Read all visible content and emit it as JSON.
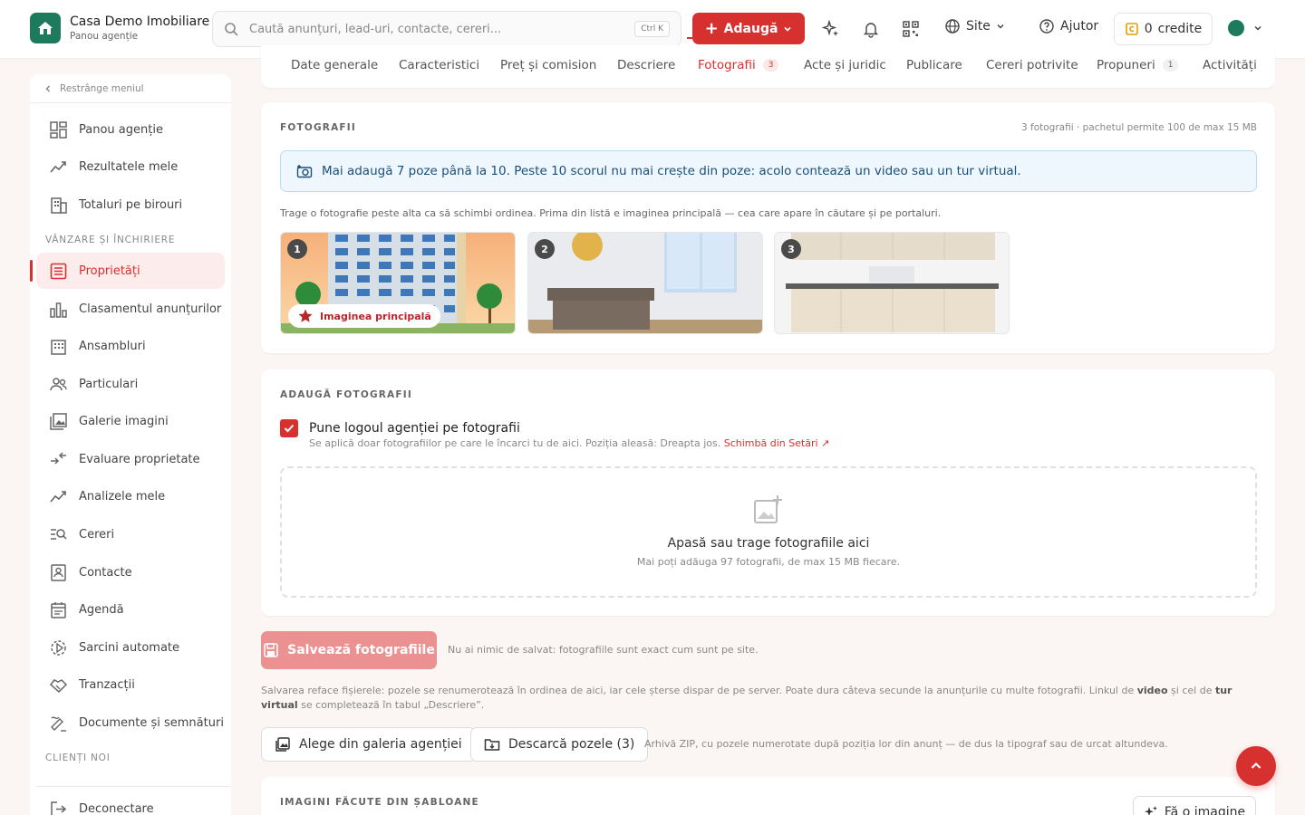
{
  "brand": {
    "name": "Casa Demo Imobiliare",
    "subtitle": "Panou agenție"
  },
  "search": {
    "placeholder": "Caută anunțuri, lead-uri, contacte, cereri...",
    "shortcut": "Ctrl K"
  },
  "header": {
    "add_label": "Adaugă",
    "site_label": "Site",
    "help_label": "Ajutor",
    "credits_count": "0",
    "credits_label": "credite"
  },
  "sidebar": {
    "collapse_label": "Restrânge meniul",
    "items": [
      {
        "label": "Panou agenție",
        "icon": "dashboard-icon"
      },
      {
        "label": "Rezultatele mele",
        "icon": "chart-line-icon"
      },
      {
        "label": "Totaluri pe birouri",
        "icon": "building-icon"
      },
      {
        "label": "Proprietăți",
        "icon": "list-icon",
        "active": true
      },
      {
        "label": "Clasamentul anunțurilor",
        "icon": "bar-chart-icon"
      },
      {
        "label": "Ansambluri",
        "icon": "apartment-icon"
      },
      {
        "label": "Particulari",
        "icon": "users-icon"
      },
      {
        "label": "Galerie imagini",
        "icon": "gallery-icon"
      },
      {
        "label": "Evaluare proprietate",
        "icon": "evaluate-icon"
      },
      {
        "label": "Analizele mele",
        "icon": "analytics-icon"
      },
      {
        "label": "Cereri",
        "icon": "search-list-icon"
      },
      {
        "label": "Contacte",
        "icon": "contacts-icon"
      },
      {
        "label": "Agendă",
        "icon": "calendar-icon"
      },
      {
        "label": "Sarcini automate",
        "icon": "automation-icon"
      },
      {
        "label": "Tranzacții",
        "icon": "handshake-icon"
      },
      {
        "label": "Documente și semnături",
        "icon": "signature-icon"
      },
      {
        "label": "Deconectare",
        "icon": "logout-icon"
      }
    ],
    "sections": [
      "Vânzare și închiriere",
      "Clienți noi"
    ]
  },
  "tabs": [
    {
      "label": "Date generale"
    },
    {
      "label": "Caracteristici"
    },
    {
      "label": "Preț și comision"
    },
    {
      "label": "Descriere"
    },
    {
      "label": "Fotografii",
      "count": "3",
      "active": true
    },
    {
      "label": "Acte și juridic"
    },
    {
      "label": "Publicare"
    },
    {
      "label": "Cereri potrivite"
    },
    {
      "label": "Propuneri",
      "count": "1"
    },
    {
      "label": "Activități"
    }
  ],
  "photos_card": {
    "title": "FOTOGRAFII",
    "meta": "3 fotografii · pachetul permite 100 de max 15 MB",
    "info": "Mai adaugă 7 poze până la 10. Peste 10 scorul nu mai crește din poze: acolo contează un video sau un tur virtual.",
    "hint": "Trage o fotografie peste alta ca să schimbi ordinea. Prima din listă e imaginea principală — cea care apare în căutare și pe portaluri.",
    "photos": [
      {
        "num": "1",
        "badge": "Imaginea principală"
      },
      {
        "num": "2"
      },
      {
        "num": "3"
      }
    ]
  },
  "add_card": {
    "title": "ADAUGĂ FOTOGRAFII",
    "checkbox_label": "Pune logoul agenției pe fotografii",
    "checkbox_sub": "Se aplică doar fotografiilor pe care le încarci tu de aici. Poziția aleasă: Dreapta jos.",
    "checkbox_link": "Schimbă din Setări ↗",
    "drop_title": "Apasă sau trage fotografiile aici",
    "drop_sub": "Mai poți adăuga 97 fotografii, de max 15 MB fiecare."
  },
  "save": {
    "button": "Salvează fotografiile",
    "note": "Nu ai nimic de salvat: fotografiile sunt exact cum sunt pe site.",
    "info_1": "Salvarea reface fișierele: pozele se renumerotează în ordinea de aici, iar cele șterse dispar de pe server. Poate dura câteva secunde la anunțurile cu multe fotografii. Linkul de ",
    "info_video": "video",
    "info_2": " și cel de ",
    "info_tour": "tur virtual",
    "info_3": " se completează în tabul „Descriere”."
  },
  "actions": {
    "gallery_button": "Alege din galeria agenției",
    "download_button": "Descarcă pozele (3)",
    "zip_note": "Arhivă ZIP, cu pozele numerotate după poziția lor din anunț — de dus la tipograf sau de urcat altundeva."
  },
  "templates_card": {
    "title": "IMAGINI FĂCUTE DIN ȘABLOANE",
    "button": "Fă o imagine"
  },
  "colors": {
    "accent": "#d6302f",
    "brand": "#1e7a5c",
    "info_bg": "#eef7fd"
  }
}
